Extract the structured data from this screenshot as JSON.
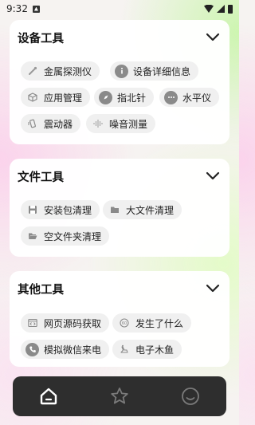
{
  "status_bar": {
    "time": "9:32"
  },
  "sections": [
    {
      "title": "设备工具",
      "tools": [
        {
          "label": "金属探测仪",
          "icon": "metal-detector-icon"
        },
        {
          "label": "设备详细信息",
          "icon": "info-icon"
        },
        {
          "label": "应用管理",
          "icon": "cube-icon"
        },
        {
          "label": "指北针",
          "icon": "compass-icon"
        },
        {
          "label": "水平仪",
          "icon": "level-icon"
        },
        {
          "label": "震动器",
          "icon": "vibration-icon"
        },
        {
          "label": "噪音测量",
          "icon": "sound-wave-icon"
        }
      ]
    },
    {
      "title": "文件工具",
      "tools": [
        {
          "label": "安装包清理",
          "icon": "save-icon"
        },
        {
          "label": "大文件清理",
          "icon": "folder-icon"
        },
        {
          "label": "空文件夹清理",
          "icon": "open-folder-icon"
        }
      ]
    },
    {
      "title": "其他工具",
      "tools": [
        {
          "label": "网页源码获取",
          "icon": "code-window-icon"
        },
        {
          "label": "发生了什么",
          "icon": "search-circle-icon"
        },
        {
          "label": "模拟微信来电",
          "icon": "phone-icon"
        },
        {
          "label": "电子木鱼",
          "icon": "wooden-fish-icon"
        }
      ]
    }
  ],
  "bottom_nav": [
    {
      "name": "home",
      "icon": "home-icon",
      "active": true
    },
    {
      "name": "favorites",
      "icon": "star-icon",
      "active": false
    },
    {
      "name": "profile",
      "icon": "smile-icon",
      "active": false
    }
  ],
  "colors": {
    "nav_bg": "#2e2e2e",
    "chip_bg": "#f0f0f0",
    "icon_gray": "#8a8a8a"
  }
}
